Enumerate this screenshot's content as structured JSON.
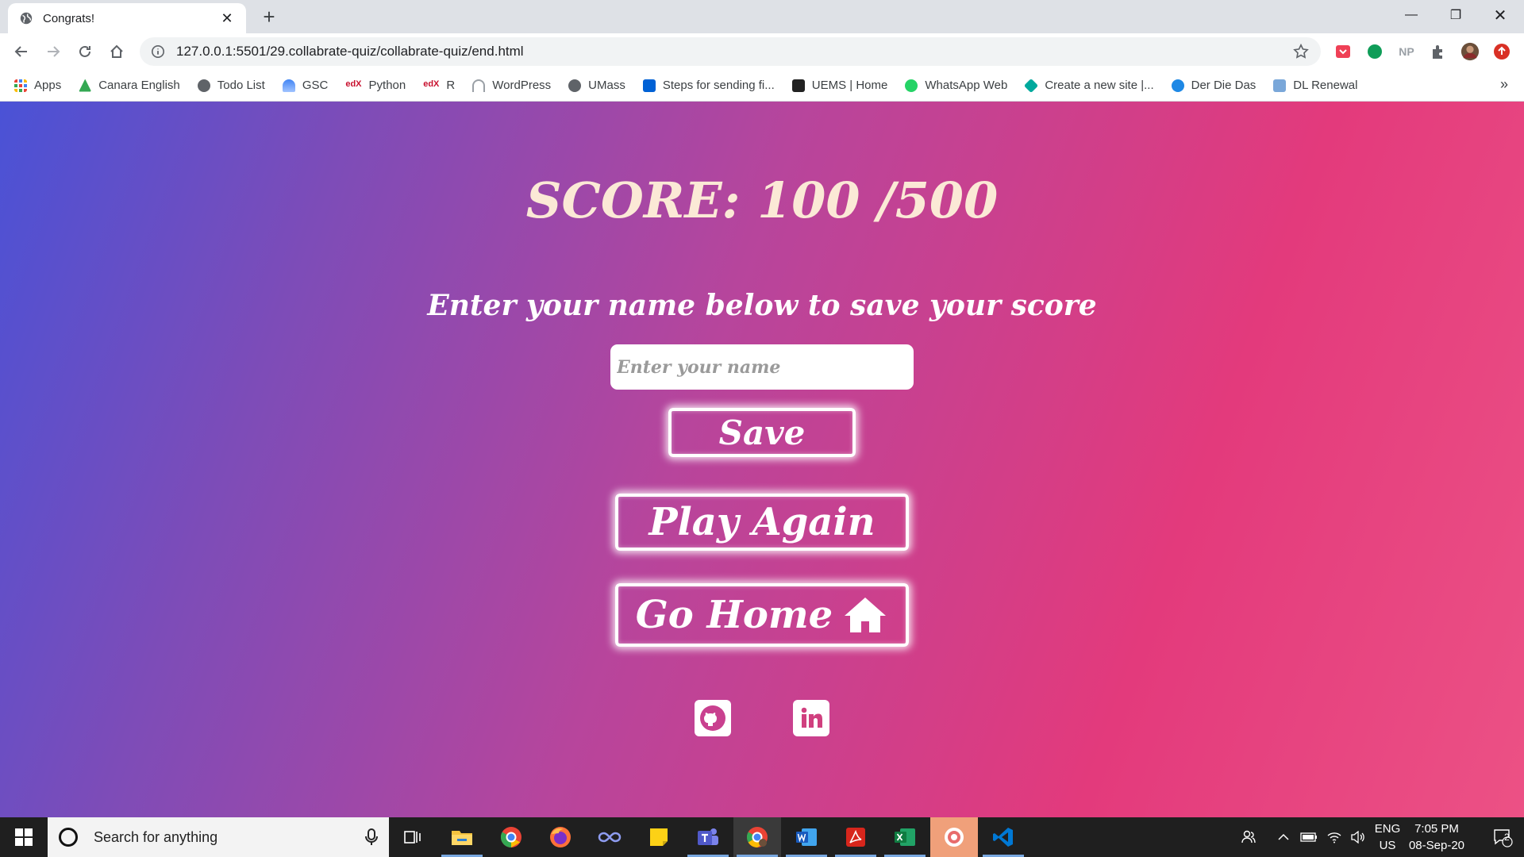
{
  "browser": {
    "tab": {
      "title": "Congrats!",
      "close": "✕"
    },
    "new_tab": "+",
    "window_controls": {
      "minimize": "—",
      "maximize": "❐",
      "close": "✕"
    },
    "url": "127.0.0.1:5501/29.collabrate-quiz/collabrate-quiz/end.html",
    "extensions": {
      "np_label": "NP"
    },
    "bookmarks": [
      {
        "label": "Apps",
        "icon": "apps-grid-icon",
        "color": "#ea4335"
      },
      {
        "label": "Canara English",
        "icon": "canara-icon",
        "color": "#34a853"
      },
      {
        "label": "Todo List",
        "icon": "globe-icon",
        "color": "#5f6368"
      },
      {
        "label": "GSC",
        "icon": "gsc-icon",
        "color": "#4285f4"
      },
      {
        "label": "Python",
        "icon": "edx-icon",
        "color": "#c8102e"
      },
      {
        "label": "R",
        "icon": "edx-icon",
        "color": "#c8102e"
      },
      {
        "label": "WordPress",
        "icon": "wifi-icon",
        "color": "#9aa0a6"
      },
      {
        "label": "UMass",
        "icon": "globe-icon",
        "color": "#5f6368"
      },
      {
        "label": "Steps for sending fi...",
        "icon": "box-icon",
        "color": "#0061d5"
      },
      {
        "label": "UEMS | Home",
        "icon": "uems-icon",
        "color": "#222222"
      },
      {
        "label": "WhatsApp Web",
        "icon": "whatsapp-icon",
        "color": "#25d366"
      },
      {
        "label": "Create a new site |...",
        "icon": "diamond-icon",
        "color": "#00a99d"
      },
      {
        "label": "Der Die Das",
        "icon": "derdiedas-icon",
        "color": "#1e88e5"
      },
      {
        "label": "DL Renewal",
        "icon": "dl-icon",
        "color": "#7aa7d9"
      }
    ],
    "bookmarks_more": "»"
  },
  "page": {
    "score_text": "SCORE:  100 /500",
    "prompt": "Enter your name below to save your score",
    "name_input": {
      "placeholder": "Enter your name",
      "value": ""
    },
    "save_label": "Save",
    "play_again_label": "Play Again",
    "go_home_label": "Go Home",
    "socials": [
      "github-icon",
      "linkedin-icon"
    ]
  },
  "taskbar": {
    "search_placeholder": "Search for anything",
    "apps": [
      "task-view-icon",
      "file-explorer-icon",
      "chrome-icon",
      "firefox-icon",
      "infinity-icon",
      "sticky-notes-icon",
      "teams-icon",
      "chrome-active-icon",
      "word-icon",
      "acrobat-icon",
      "excel-icon",
      "pomodoro-icon",
      "vscode-icon"
    ],
    "lang_top": "ENG",
    "lang_bottom": "US",
    "time": "7:05 PM",
    "date": "08-Sep-20",
    "notification_count": "2"
  },
  "colors": {
    "gradient_start": "#4a52d6",
    "gradient_mid": "#b7459c",
    "gradient_end": "#ec5185",
    "score_text": "#fbe9d6"
  }
}
